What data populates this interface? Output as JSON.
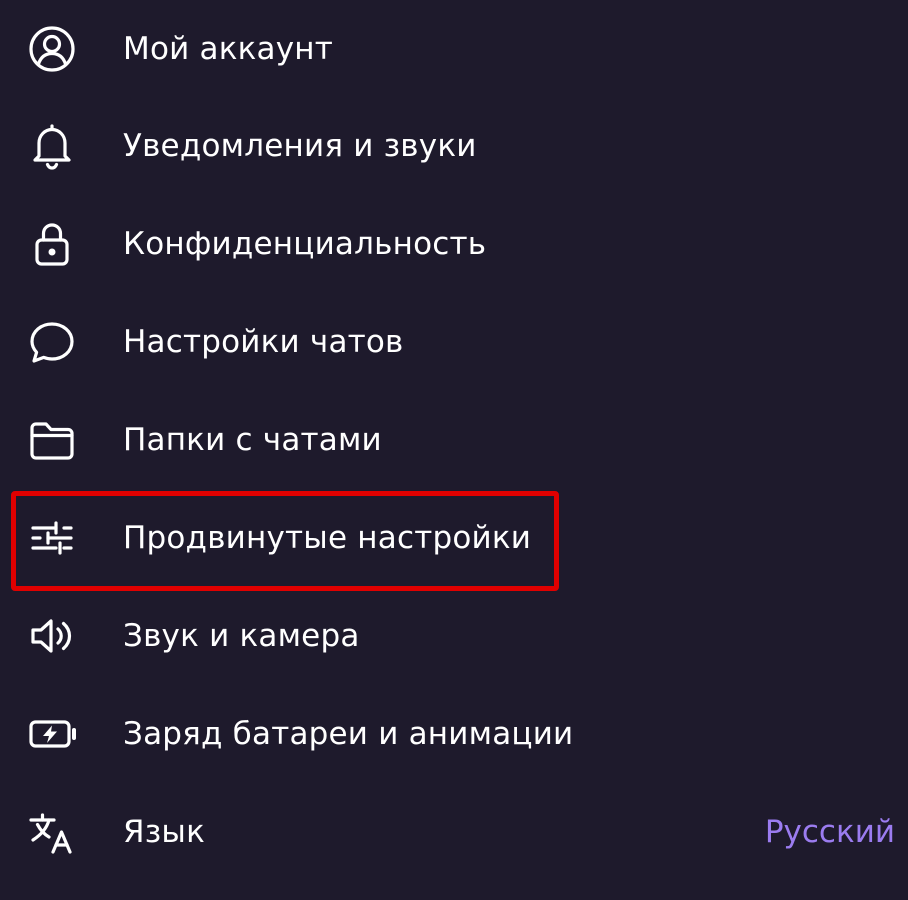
{
  "menu": {
    "items": [
      {
        "label": "Мой аккаунт",
        "icon": "user-circle-icon"
      },
      {
        "label": "Уведомления и звуки",
        "icon": "bell-icon"
      },
      {
        "label": "Конфиденциальность",
        "icon": "lock-icon"
      },
      {
        "label": "Настройки чатов",
        "icon": "chat-bubble-icon"
      },
      {
        "label": "Папки с чатами",
        "icon": "folder-icon"
      },
      {
        "label": "Продвинутые настройки",
        "icon": "sliders-icon"
      },
      {
        "label": "Звук и камера",
        "icon": "speaker-icon"
      },
      {
        "label": "Заряд батареи и анимации",
        "icon": "battery-icon"
      },
      {
        "label": "Язык",
        "icon": "translate-icon",
        "value": "Русский"
      }
    ]
  },
  "colors": {
    "background": "#1e1a2c",
    "text": "#ffffff",
    "accent": "#9b7cf0",
    "highlight": "#e00000"
  }
}
